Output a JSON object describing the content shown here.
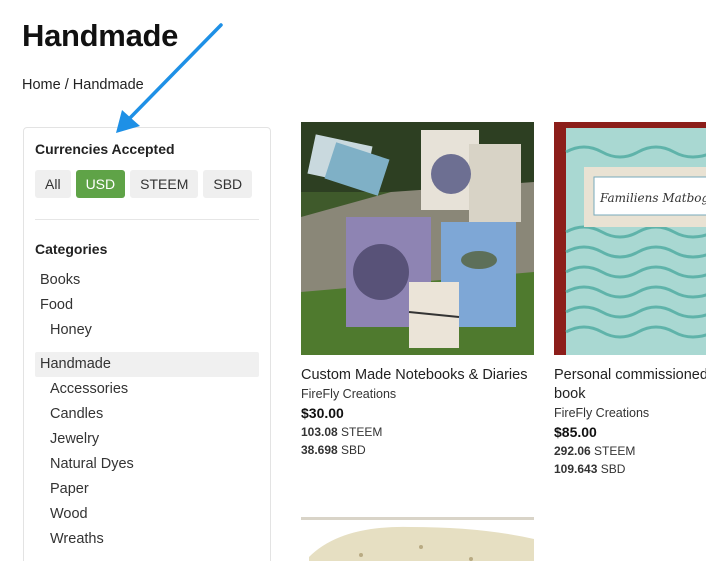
{
  "page": {
    "title": "Handmade"
  },
  "breadcrumb": {
    "home": "Home",
    "separator": " / ",
    "current": "Handmade"
  },
  "sidebar": {
    "currencies_heading": "Currencies Accepted",
    "currencies": [
      "All",
      "USD",
      "STEEM",
      "SBD"
    ],
    "active_currency": "USD",
    "categories_heading": "Categories",
    "categories": [
      {
        "label": "Books"
      },
      {
        "label": "Food"
      },
      {
        "label": "Honey"
      },
      {
        "label": "Handmade"
      },
      {
        "label": "Accessories"
      },
      {
        "label": "Candles"
      },
      {
        "label": "Jewelry"
      },
      {
        "label": "Natural Dyes"
      },
      {
        "label": "Paper"
      },
      {
        "label": "Wood"
      },
      {
        "label": "Wreaths"
      }
    ]
  },
  "products": [
    {
      "name": "Custom Made Notebooks & Diaries",
      "shop": "FireFly Creations",
      "price": "$30.00",
      "steem_value": "103.08",
      "steem_unit": "STEEM",
      "sbd_value": "38.698",
      "sbd_unit": "SBD"
    },
    {
      "name": "Personal commissioned book",
      "shop": "FireFly Creations",
      "price": "$85.00",
      "steem_value": "292.06",
      "steem_unit": "STEEM",
      "sbd_value": "109.643",
      "sbd_unit": "SBD",
      "cover_text": "Familiens Matbog"
    }
  ],
  "colors": {
    "accent": "#5fa347",
    "annotation_arrow": "#1e90e6"
  }
}
